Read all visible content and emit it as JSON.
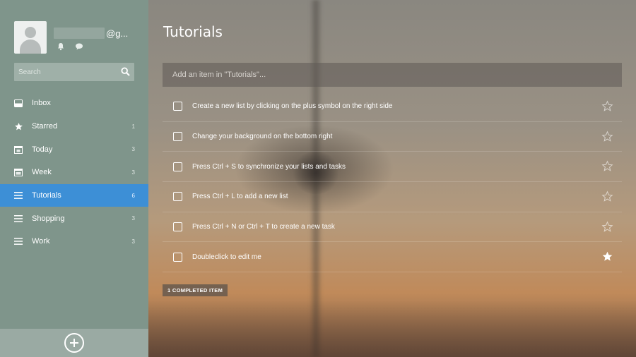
{
  "user": {
    "email_suffix": "@g..."
  },
  "search": {
    "placeholder": "Search"
  },
  "sidebar": {
    "items": [
      {
        "label": "Inbox",
        "count": "",
        "icon": "inbox-icon"
      },
      {
        "label": "Starred",
        "count": "1",
        "icon": "star-icon"
      },
      {
        "label": "Today",
        "count": "3",
        "icon": "calendar-today-icon"
      },
      {
        "label": "Week",
        "count": "3",
        "icon": "calendar-week-icon"
      },
      {
        "label": "Tutorials",
        "count": "6",
        "icon": "list-icon",
        "active": true
      },
      {
        "label": "Shopping",
        "count": "3",
        "icon": "list-icon"
      },
      {
        "label": "Work",
        "count": "3",
        "icon": "list-icon"
      }
    ]
  },
  "main": {
    "title": "Tutorials",
    "add_placeholder": "Add an item in \"Tutorials\"...",
    "tasks": [
      {
        "text": "Create a new list by clicking on the plus symbol on the right side",
        "starred": false
      },
      {
        "text": "Change your background on the bottom right",
        "starred": false
      },
      {
        "text": "Press Ctrl + S to synchronize your lists and tasks",
        "starred": false
      },
      {
        "text": "Press Ctrl + L to add a new list",
        "starred": false
      },
      {
        "text": "Press Ctrl + N or Ctrl + T to create a new task",
        "starred": false
      },
      {
        "text": "Doubleclick to edit me",
        "starred": true
      }
    ],
    "completed_label": "1 COMPLETED ITEM"
  },
  "colors": {
    "sidebar_bg": "#7f958b",
    "active_item": "#3d8fd6"
  }
}
